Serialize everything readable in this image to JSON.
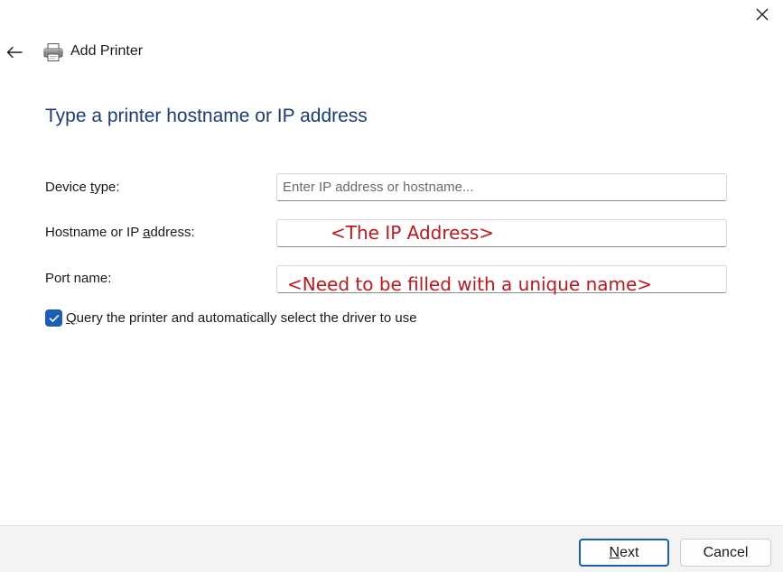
{
  "header": {
    "title": "Add Printer",
    "back_icon": "back-arrow-icon",
    "printer_icon": "printer-icon",
    "close_icon": "close-icon"
  },
  "page": {
    "heading": "Type a printer hostname or IP address"
  },
  "form": {
    "device_type": {
      "label_pre": "Device ",
      "label_key": "t",
      "label_post": "ype:",
      "placeholder": "Enter IP address or hostname...",
      "value": ""
    },
    "hostname": {
      "label_pre": "Hostname or IP ",
      "label_key": "a",
      "label_post": "ddress:",
      "value": "",
      "annotation": "<The IP Address>"
    },
    "port_name": {
      "label": "Port name:",
      "value": "",
      "annotation": "<Need to be filled with a unique name>"
    },
    "query_printer": {
      "checked": true,
      "label_key": "Q",
      "label_rest": "uery the printer and automatically select the driver to use"
    }
  },
  "footer": {
    "next_key": "N",
    "next_rest": "ext",
    "cancel_label": "Cancel"
  },
  "colors": {
    "heading": "#1c3c78",
    "accent": "#1a5fb4",
    "annotation": "#c0161c",
    "footer_bg": "#f3f3f3"
  }
}
